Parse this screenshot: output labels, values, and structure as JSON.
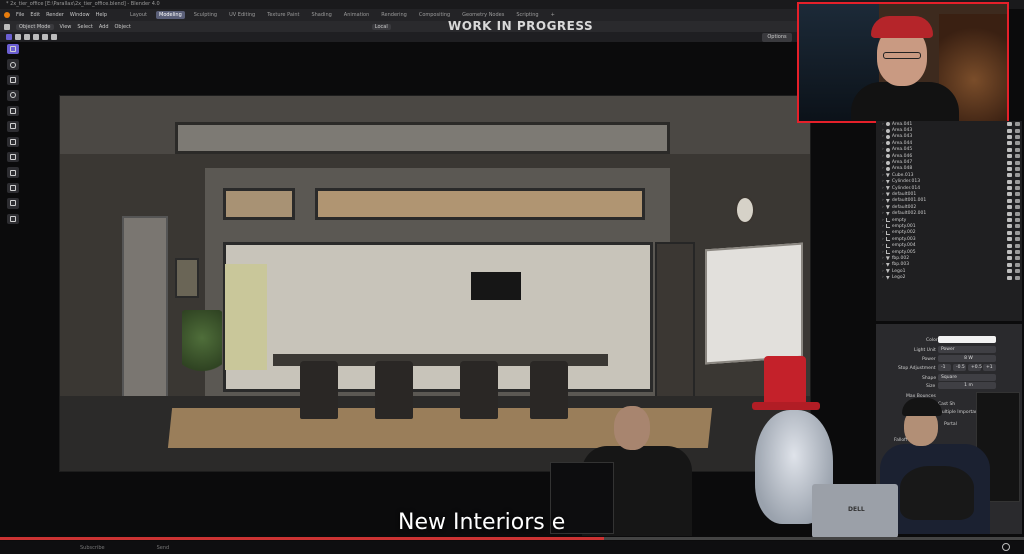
{
  "window": {
    "title": "* 2x_tier_office [E:\\Parallax\\2x_tier_office.blend] - Blender 4.0"
  },
  "menu": [
    "File",
    "Edit",
    "Render",
    "Window",
    "Help"
  ],
  "workspaces": [
    {
      "label": "Layout",
      "active": false
    },
    {
      "label": "Modeling",
      "active": true
    },
    {
      "label": "Sculpting",
      "active": false
    },
    {
      "label": "UV Editing",
      "active": false
    },
    {
      "label": "Texture Paint",
      "active": false
    },
    {
      "label": "Shading",
      "active": false
    },
    {
      "label": "Animation",
      "active": false
    },
    {
      "label": "Rendering",
      "active": false
    },
    {
      "label": "Compositing",
      "active": false
    },
    {
      "label": "Geometry Nodes",
      "active": false
    },
    {
      "label": "Scripting",
      "active": false
    }
  ],
  "header": {
    "mode": "Object Mode",
    "view": "View",
    "select": "Select",
    "add": "Add",
    "object": "Object",
    "transform": "Local",
    "options": "Options"
  },
  "overlay_text": "WORK IN PROGRESS",
  "outliner": {
    "rows": [
      {
        "label": "Area.041",
        "kind": "light"
      },
      {
        "label": "Area.043",
        "kind": "light"
      },
      {
        "label": "Area.043",
        "kind": "light"
      },
      {
        "label": "Area.044",
        "kind": "light"
      },
      {
        "label": "Area.045",
        "kind": "light"
      },
      {
        "label": "Area.046",
        "kind": "light"
      },
      {
        "label": "Area.047",
        "kind": "light"
      },
      {
        "label": "Area.048",
        "kind": "light"
      },
      {
        "label": "Cube.013",
        "kind": "mesh"
      },
      {
        "label": "Cylinder.013",
        "kind": "mesh"
      },
      {
        "label": "Cylinder.014",
        "kind": "mesh"
      },
      {
        "label": "default001",
        "kind": "mesh"
      },
      {
        "label": "default001.001",
        "kind": "mesh"
      },
      {
        "label": "default002",
        "kind": "mesh"
      },
      {
        "label": "default002.001",
        "kind": "mesh"
      },
      {
        "label": "empty",
        "kind": "empty"
      },
      {
        "label": "empty.001",
        "kind": "empty"
      },
      {
        "label": "empty.002",
        "kind": "empty"
      },
      {
        "label": "empty.003",
        "kind": "empty"
      },
      {
        "label": "empty.004",
        "kind": "empty"
      },
      {
        "label": "empty.005",
        "kind": "empty"
      },
      {
        "label": "fbp.002",
        "kind": "mesh"
      },
      {
        "label": "fbp.003",
        "kind": "mesh"
      },
      {
        "label": "Lego1",
        "kind": "mesh"
      },
      {
        "label": "Lego2",
        "kind": "mesh"
      }
    ]
  },
  "properties": {
    "color_label": "Color",
    "light_unit_label": "Light Unit",
    "light_unit_value": "Power",
    "power_label": "Power",
    "power_value": "8 W",
    "stop_adj_label": "Stop Adjustment",
    "stop_adj_values": [
      "-1",
      "-0.5",
      "+0.5",
      "+1"
    ],
    "shape_label": "Shape",
    "shape_value": "Square",
    "size_label": "Size",
    "size_value": "1 m",
    "max_bounces_label": "Max Bounces",
    "cast_shadow_label": "Cast Sh",
    "multiple_importance_label": "Multiple Importance",
    "falloff_label": "Falloff",
    "portal_label": "Portal"
  },
  "video": {
    "caption": "New Interiors e",
    "progress": 0.59,
    "laptop_brand": "DELL",
    "bar_items": [
      "Subscribe",
      "Send"
    ]
  },
  "colors": {
    "accent_blender": "#6b5fd1",
    "webcam_border": "#e5202a",
    "progress": "#cc3333"
  }
}
